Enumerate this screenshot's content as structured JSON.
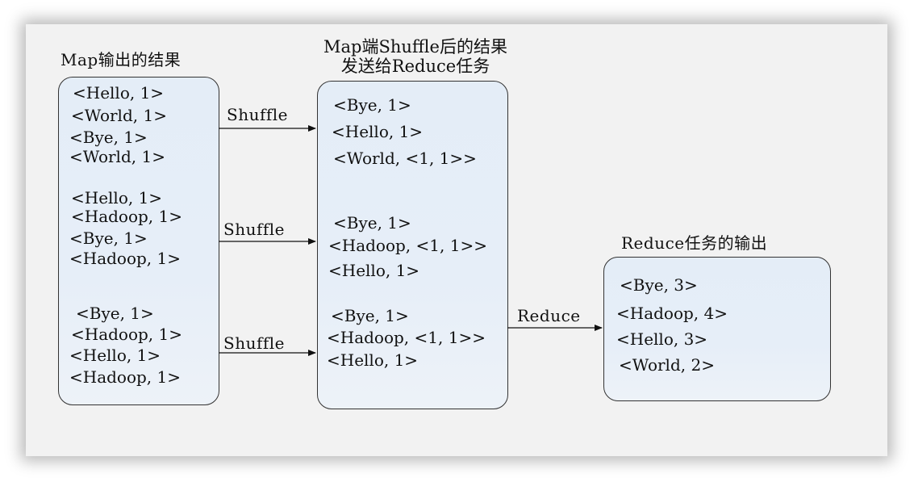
{
  "titles": {
    "map_output": "Map输出的结果",
    "shuffle_result_line1": "Map端Shuffle后的结果",
    "shuffle_result_line2": "发送给Reduce任务",
    "reduce_output": "Reduce任务的输出"
  },
  "map_output_items": [
    "<Hello, 1>",
    "<World, 1>",
    "<Bye, 1>",
    "<World, 1>",
    "<Hello, 1>",
    "<Hadoop, 1>",
    "<Bye, 1>",
    "<Hadoop, 1>",
    "<Bye, 1>",
    "<Hadoop, 1>",
    "<Hello, 1>",
    "<Hadoop, 1>"
  ],
  "shuffle_items": [
    "<Bye, 1>",
    "<Hello, 1>",
    "<World, <1, 1>>",
    "<Bye, 1>",
    "<Hadoop, <1, 1>>",
    "<Hello, 1>",
    "<Bye, 1>",
    "<Hadoop, <1, 1>>",
    "<Hello, 1>"
  ],
  "reduce_items": [
    "<Bye, 3>",
    "<Hadoop, 4>",
    "<Hello, 3>",
    "<World, 2>"
  ],
  "edges": {
    "shuffle_1": "Shuffle",
    "shuffle_2": "Shuffle",
    "shuffle_3": "Shuffle",
    "reduce": "Reduce"
  }
}
